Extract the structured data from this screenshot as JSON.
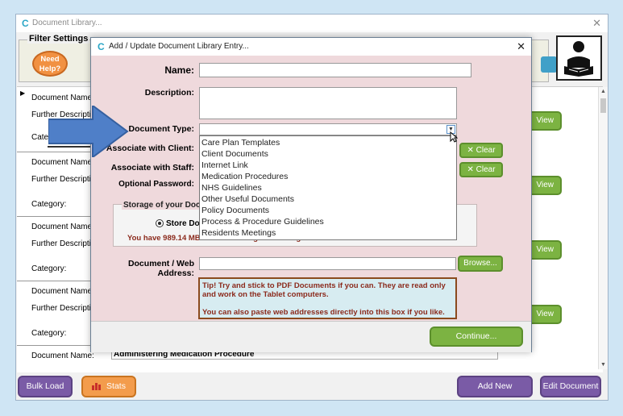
{
  "main_window": {
    "title": "Document Library...",
    "close_glyph": "✕",
    "app_icon": "C"
  },
  "filter": {
    "title": "Filter Settings",
    "need_help": "Need Help?"
  },
  "list": {
    "label_name": "Document Name:",
    "label_desc": "Further Description",
    "label_cat": "Category:",
    "label_cat_short": "Categ",
    "view_label": "View",
    "last_name_value": "Administering Medication Procedure"
  },
  "bottom": {
    "bulk_load": "Bulk Load",
    "stats": "Stats",
    "add_new": "Add New",
    "edit_document": "Edit Document"
  },
  "dialog": {
    "title": "Add / Update Document Library Entry...",
    "close_glyph": "✕",
    "name_label": "Name:",
    "description_label": "Description:",
    "doc_type_label": "Document Type:",
    "client_label": "Associate with Client:",
    "staff_label": "Associate with Staff:",
    "password_label": "Optional Password:",
    "clear_label": "Clear",
    "storage_title": "Storage of your Docun",
    "storage_option": "Store Doc",
    "storage_note": "You have 989.14 MB of cloud storage remaining.",
    "address_label": "Document / Web Address:",
    "browse_label": "Browse...",
    "tip_line1": "Tip! Try and stick to PDF Documents if you can.  They are read only and work on the Tablet computers.",
    "tip_line2": "You can also paste web addresses directly into this box if you like.",
    "continue_label": "Continue..."
  },
  "doc_type_options": [
    "Care Plan Templates",
    "Client Documents",
    "Internet Link",
    "Medication Procedures",
    "NHS Guidelines",
    "Other Useful Documents",
    "Policy Documents",
    "Process & Procedure Guidelines",
    "Residents Meetings"
  ],
  "colors": {
    "accent_green": "#7cb342",
    "purple": "#7a5ba6",
    "orange": "#f39c4c",
    "dialog_bg": "#efd9dc",
    "arrow_blue": "#4f7fc8"
  }
}
